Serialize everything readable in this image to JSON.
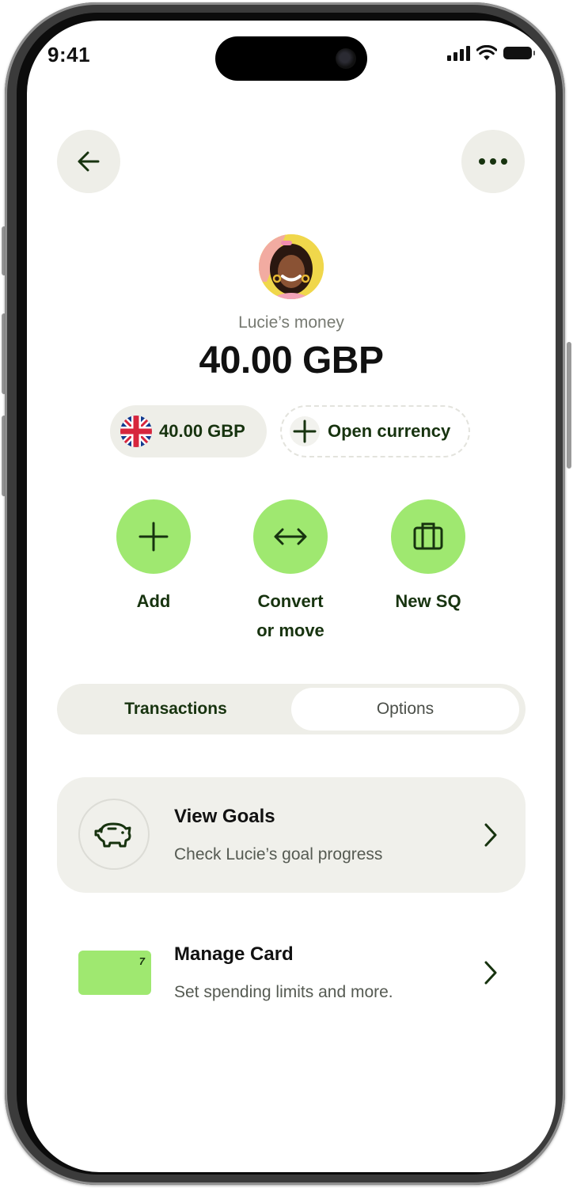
{
  "status_bar": {
    "time": "9:41"
  },
  "profile": {
    "owner_label": "Lucie’s money",
    "balance": "40.00 GBP"
  },
  "currencies": {
    "gbp_chip": "40.00 GBP",
    "open_currency": "Open currency"
  },
  "actions": [
    {
      "label": "Add",
      "icon": "plus-icon"
    },
    {
      "label": "Convert\nor move",
      "icon": "arrows-left-right-icon"
    },
    {
      "label": "New SQ",
      "icon": "jar-icon"
    }
  ],
  "tabs": [
    {
      "label": "Transactions",
      "selected": false
    },
    {
      "label": "Options",
      "selected": true
    }
  ],
  "menu": [
    {
      "title": "View Goals",
      "subtitle": "Check Lucie’s goal progress",
      "icon": "piggy-bank-icon"
    },
    {
      "title": "Manage Card",
      "subtitle": "Set spending limits and more.",
      "icon": "card-icon",
      "card_mark": "7"
    }
  ],
  "colors": {
    "accent": "#9fe870",
    "dark_text": "#17330f",
    "surface": "#eeeee8"
  }
}
